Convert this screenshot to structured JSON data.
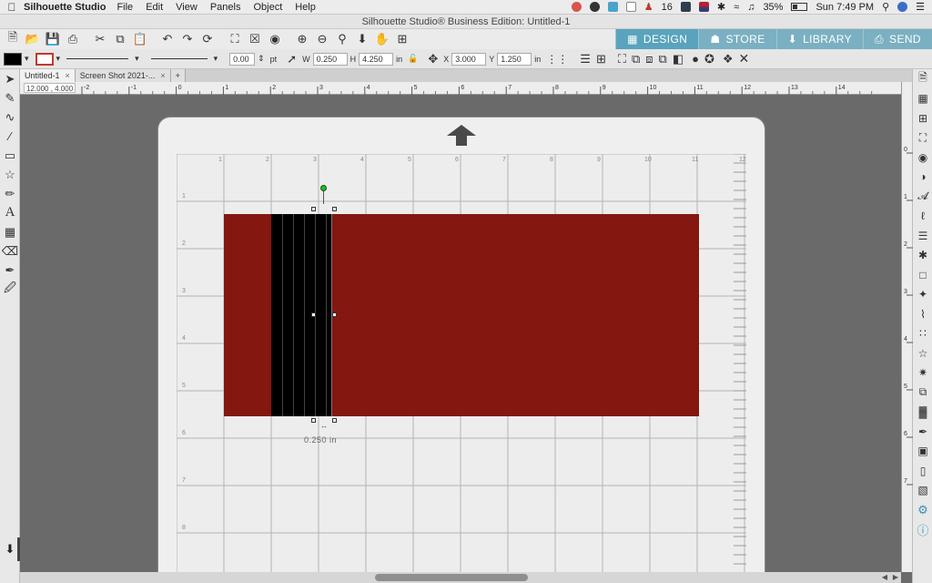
{
  "menubar": {
    "app_name": "Silhouette Studio",
    "menus": [
      "File",
      "Edit",
      "View",
      "Panels",
      "Object",
      "Help"
    ],
    "badge_count": "16",
    "battery": "35%",
    "datetime": "Sun 7:49 PM"
  },
  "window_title": "Silhouette Studio® Business Edition: Untitled-1",
  "nav_tabs": [
    {
      "label": "DESIGN",
      "icon": "grid-icon",
      "active": true
    },
    {
      "label": "STORE",
      "icon": "store-icon",
      "active": false
    },
    {
      "label": "LIBRARY",
      "icon": "library-icon",
      "active": false
    },
    {
      "label": "SEND",
      "icon": "send-icon",
      "active": false
    }
  ],
  "properties": {
    "fill_color": "#000000",
    "line_width_value": "0.00",
    "line_width_unit": "pt",
    "w_label": "W",
    "w_value": "0.250",
    "h_label": "H",
    "h_value": "4.250",
    "unit": "in",
    "x_label": "X",
    "x_value": "3.000",
    "y_label": "Y",
    "y_value": "1.250",
    "unit2": "in"
  },
  "doc_tabs": [
    {
      "label": "Untitled-1",
      "active": true
    },
    {
      "label": "Screen Shot 2021-...",
      "active": false
    }
  ],
  "add_tab_label": "+",
  "cursor_coords": "12.000 , 4.000",
  "ruler": {
    "h_ticks": [
      "-2",
      "-1",
      "0",
      "1",
      "2",
      "3",
      "4",
      "5",
      "6",
      "7",
      "8",
      "9",
      "10",
      "11",
      "12",
      "13",
      "14"
    ],
    "grid_top_ticks": [
      "1",
      "2",
      "3",
      "4",
      "5",
      "6",
      "7",
      "8",
      "9",
      "10",
      "11",
      "12"
    ],
    "grid_left_ticks": [
      "1",
      "2",
      "3",
      "4",
      "5",
      "6",
      "7",
      "8"
    ],
    "v_ticks": [
      "0",
      "1",
      "2",
      "3",
      "4",
      "5",
      "6",
      "7"
    ]
  },
  "dimension_label": "0.250 in",
  "colors": {
    "red_rect": "#84170f",
    "black_strip": "#000000",
    "accent": "#5aa3bd",
    "rotate_handle": "#22bb22"
  }
}
